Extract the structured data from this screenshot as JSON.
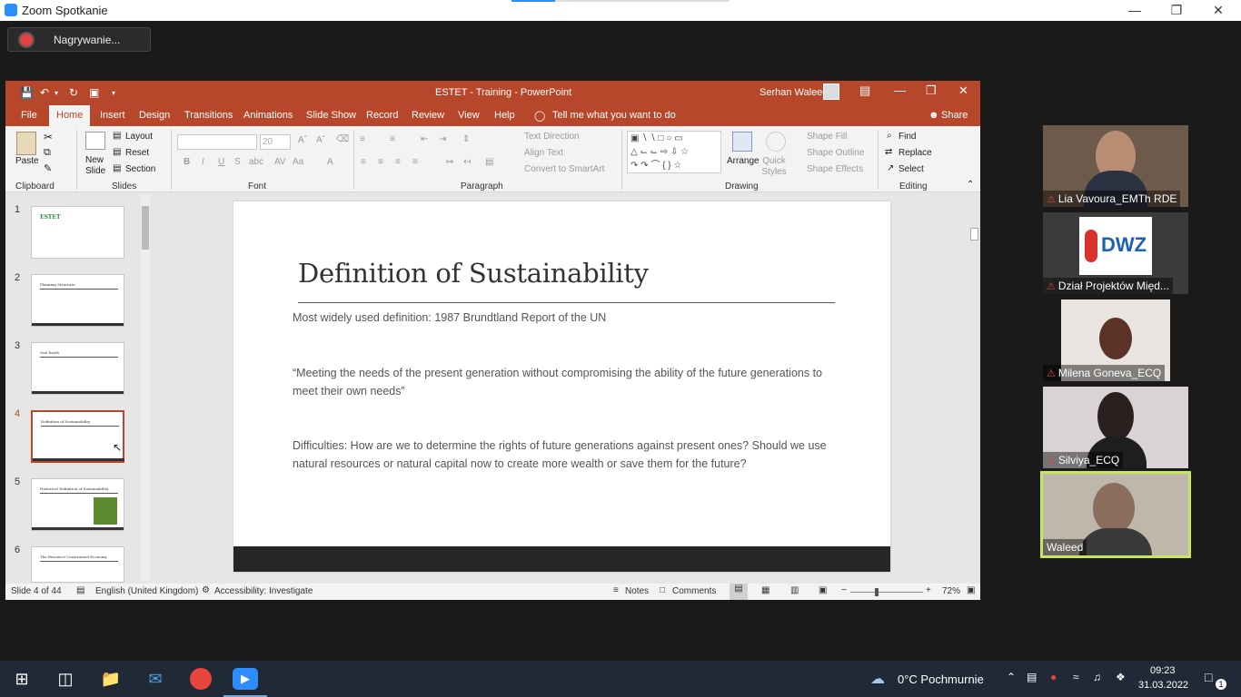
{
  "zoom": {
    "window_title": "Zoom Spotkanie",
    "recording_label": "Nagrywanie...",
    "participants": [
      {
        "name": "Lia Vavoura_EMTh RDE",
        "muted": true
      },
      {
        "name": "Dział Projektów Międ...",
        "muted": true
      },
      {
        "name": "Milena Goneva_ECQ",
        "muted": true
      },
      {
        "name": "Silviya_ECQ",
        "muted": true
      },
      {
        "name": "Waleed",
        "muted": false,
        "speaking": true
      }
    ],
    "dwz_logo_text": "DWZ"
  },
  "ppt": {
    "title": "ESTET - Training  -  PowerPoint",
    "user": "Serhan Waleed",
    "menu": [
      "File",
      "Home",
      "Insert",
      "Design",
      "Transitions",
      "Animations",
      "Slide Show",
      "Record",
      "Review",
      "View",
      "Help"
    ],
    "tell_me": "Tell me what you want to do",
    "share": "Share",
    "ribbon": {
      "clipboard": {
        "paste": "Paste",
        "label": "Clipboard"
      },
      "slides": {
        "new_slide": "New Slide",
        "layout": "Layout",
        "reset": "Reset",
        "section": "Section",
        "label": "Slides"
      },
      "font": {
        "label": "Font",
        "size": "20"
      },
      "paragraph": {
        "text_direction": "Text Direction",
        "align_text": "Align Text",
        "convert": "Convert to SmartArt",
        "label": "Paragraph"
      },
      "drawing": {
        "arrange": "Arrange",
        "quick_styles": "Quick Styles",
        "shape_fill": "Shape Fill",
        "shape_outline": "Shape Outline",
        "shape_effects": "Shape Effects",
        "label": "Drawing"
      },
      "editing": {
        "find": "Find",
        "replace": "Replace",
        "select": "Select",
        "label": "Editing"
      }
    },
    "thumbnails": [
      {
        "num": "1",
        "title": "ESTET"
      },
      {
        "num": "2",
        "title": "Planning Structure"
      },
      {
        "num": "3",
        "title": "One Earth"
      },
      {
        "num": "4",
        "title": "Definition of Sustainability"
      },
      {
        "num": "5",
        "title": "Historical Definition of Sustainability"
      },
      {
        "num": "6",
        "title": "The Resource Constrained Economy"
      }
    ],
    "selected_slide": 4,
    "slide": {
      "title": "Definition of Sustainability",
      "p1": "Most widely used definition: 1987 Brundtland Report of the UN",
      "p2": "“Meeting the needs of the present generation without compromising the ability of the future generations to meet their own needs”",
      "p3": "Difficulties: How are we to determine the rights of future generations against present ones? Should we use natural resources or natural capital now to create more wealth or save them for the future?"
    },
    "status": {
      "slide_of": "Slide 4 of 44",
      "language": "English (United Kingdom)",
      "accessibility": "Accessibility: Investigate",
      "notes": "Notes",
      "comments": "Comments",
      "zoom": "72%"
    }
  },
  "taskbar": {
    "weather": "0°C  Pochmurnie",
    "time": "09:23",
    "date": "31.03.2022",
    "notifications": "1"
  },
  "colors": {
    "ppt_accent": "#b7472a",
    "zoom_blue": "#2d8cff",
    "speaker_border": "#c8e65a"
  }
}
